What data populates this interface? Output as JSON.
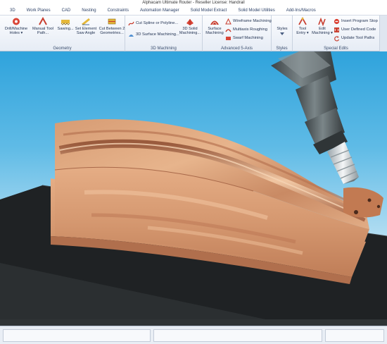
{
  "window": {
    "title": "Alphacam Ultimate Router - Reseller License: Handrail"
  },
  "tabs": [
    "3D",
    "Work Planes",
    "CAD",
    "Nesting",
    "Constraints",
    "Automation Manager",
    "Solid Model Extract",
    "Solid Model Utilities",
    "Add-Ins/Macros"
  ],
  "ribbon": {
    "geometry": {
      "label": "Geometry",
      "drill": "Drill/Machine Holes ▾",
      "manual_tool_path": "Manual Tool Path...",
      "sawing": "Sawing...",
      "set_element_saw_angle": "Set Element Saw Angle",
      "cut_between": "Cut Between 2 Geometries..."
    },
    "machining_3d": {
      "label": "3D Machining",
      "cut_spline": "Cut Spline or Polyline...",
      "surface_machining_3d": "3D Surface Machining...",
      "solid_machining_3d": "3D Solid Machining..."
    },
    "advanced_5axis": {
      "label": "Advanced 5-Axis",
      "surface_machining": "Surface Machining",
      "wireframe_machining": "Wireframe Machining",
      "multiaxis_roughing": "Multiaxis Roughing",
      "swarf_machining": "Swarf Machining"
    },
    "styles": {
      "label": "Styles",
      "styles_button": "Styles"
    },
    "special_edits": {
      "label": "Special Edits",
      "tool_entry": "Tool Entry ▾",
      "edit_machining": "Edit Machining ▾",
      "insert_program_stop": "Insert Program Stop",
      "user_defined_code": "User Defined Code",
      "update_tool_paths": "Update Tool Paths"
    }
  },
  "colors": {
    "viewport_sky_top": "#2fa3dc",
    "wood_light": "#e7b48c",
    "wood_dark": "#b77150",
    "base_plate": "#1f2224",
    "tool_holder": "#5b6467",
    "ribbon_bg": "#e6ecf5"
  },
  "icons": {
    "drill": "drill-icon",
    "manual_tool_path": "tool-path-icon",
    "sawing": "saw-icon",
    "saw_angle": "saw-angle-icon",
    "cut_between": "cut-between-icon",
    "cut_spline": "spline-icon",
    "surface_3d": "surface-icon",
    "solid_3d": "solid-icon",
    "surface_5axis": "surface-5axis-icon",
    "wireframe": "wireframe-icon",
    "multiaxis": "multiaxis-icon",
    "swarf": "swarf-icon",
    "styles": "styles-icon",
    "tool_entry": "tool-entry-icon",
    "edit_machining": "edit-machining-icon",
    "program_stop": "stop-icon",
    "user_code": "user-code-icon",
    "update_paths": "update-icon"
  }
}
